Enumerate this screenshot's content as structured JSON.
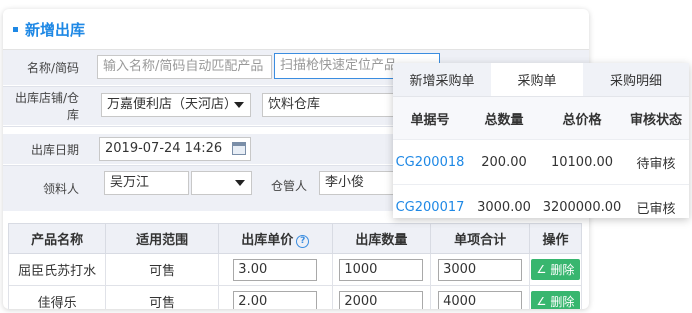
{
  "header": {
    "title": "新增出库"
  },
  "form": {
    "name_label": "名称/简码",
    "name_placeholder": "输入名称/简码自动匹配产品",
    "scan_placeholder": "扫描枪快速定位产品",
    "store_label": "出库店铺/仓库",
    "store_value": "万嘉便利店（天河店）",
    "warehouse_value": "饮料仓库",
    "date_label": "出库日期",
    "date_value": "2019-07-24 14:26",
    "receiver_label": "领料人",
    "receiver_value": "吴万江",
    "keeper_label": "仓管人",
    "keeper_value": "李小俊"
  },
  "table": {
    "headers": [
      "产品名称",
      "适用范围",
      "出库单价",
      "出库数量",
      "单项合计",
      "操作"
    ],
    "rows": [
      {
        "name": "屈臣氏苏打水",
        "scope": "可售",
        "price": "3.00",
        "qty": "1000",
        "total": "3000",
        "action": "删除"
      },
      {
        "name": "佳得乐",
        "scope": "可售",
        "price": "2.00",
        "qty": "2000",
        "total": "4000",
        "action": "删除"
      }
    ]
  },
  "popup": {
    "tabs": [
      "新增采购单",
      "采购单",
      "采购明细"
    ],
    "active_tab": "采购单",
    "headers": [
      "单据号",
      "总数量",
      "总价格",
      "审核状态"
    ],
    "rows": [
      {
        "no": "CG200018",
        "qty": "200.00",
        "price": "10100.00",
        "status": "待审核"
      },
      {
        "no": "CG200017",
        "qty": "3000.00",
        "price": "3200000.00",
        "status": "已审核"
      }
    ]
  },
  "colors": {
    "accent": "#1e88e5",
    "delete_button": "#38b66f",
    "row_bg": "#eef0f6"
  }
}
